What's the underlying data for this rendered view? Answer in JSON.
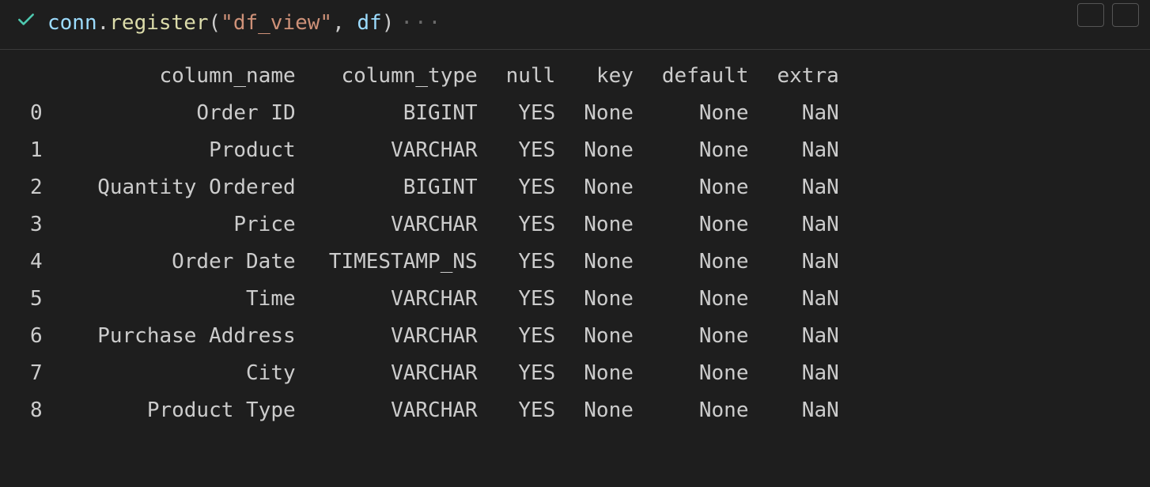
{
  "code": {
    "var": "conn",
    "dot": ".",
    "func": "register",
    "open": "(",
    "arg1": "\"df_view\"",
    "comma": ", ",
    "arg2": "df",
    "close": ")",
    "ellipsis": "···"
  },
  "table": {
    "headers": {
      "idx": "",
      "column_name": "column_name",
      "column_type": "column_type",
      "null": "null",
      "key": "key",
      "default": "default",
      "extra": "extra"
    },
    "rows": [
      {
        "idx": "0",
        "column_name": "Order ID",
        "column_type": "BIGINT",
        "null": "YES",
        "key": "None",
        "default": "None",
        "extra": "NaN"
      },
      {
        "idx": "1",
        "column_name": "Product",
        "column_type": "VARCHAR",
        "null": "YES",
        "key": "None",
        "default": "None",
        "extra": "NaN"
      },
      {
        "idx": "2",
        "column_name": "Quantity Ordered",
        "column_type": "BIGINT",
        "null": "YES",
        "key": "None",
        "default": "None",
        "extra": "NaN"
      },
      {
        "idx": "3",
        "column_name": "Price",
        "column_type": "VARCHAR",
        "null": "YES",
        "key": "None",
        "default": "None",
        "extra": "NaN"
      },
      {
        "idx": "4",
        "column_name": "Order Date",
        "column_type": "TIMESTAMP_NS",
        "null": "YES",
        "key": "None",
        "default": "None",
        "extra": "NaN"
      },
      {
        "idx": "5",
        "column_name": "Time",
        "column_type": "VARCHAR",
        "null": "YES",
        "key": "None",
        "default": "None",
        "extra": "NaN"
      },
      {
        "idx": "6",
        "column_name": "Purchase Address",
        "column_type": "VARCHAR",
        "null": "YES",
        "key": "None",
        "default": "None",
        "extra": "NaN"
      },
      {
        "idx": "7",
        "column_name": "City",
        "column_type": "VARCHAR",
        "null": "YES",
        "key": "None",
        "default": "None",
        "extra": "NaN"
      },
      {
        "idx": "8",
        "column_name": "Product Type",
        "column_type": "VARCHAR",
        "null": "YES",
        "key": "None",
        "default": "None",
        "extra": "NaN"
      }
    ]
  }
}
